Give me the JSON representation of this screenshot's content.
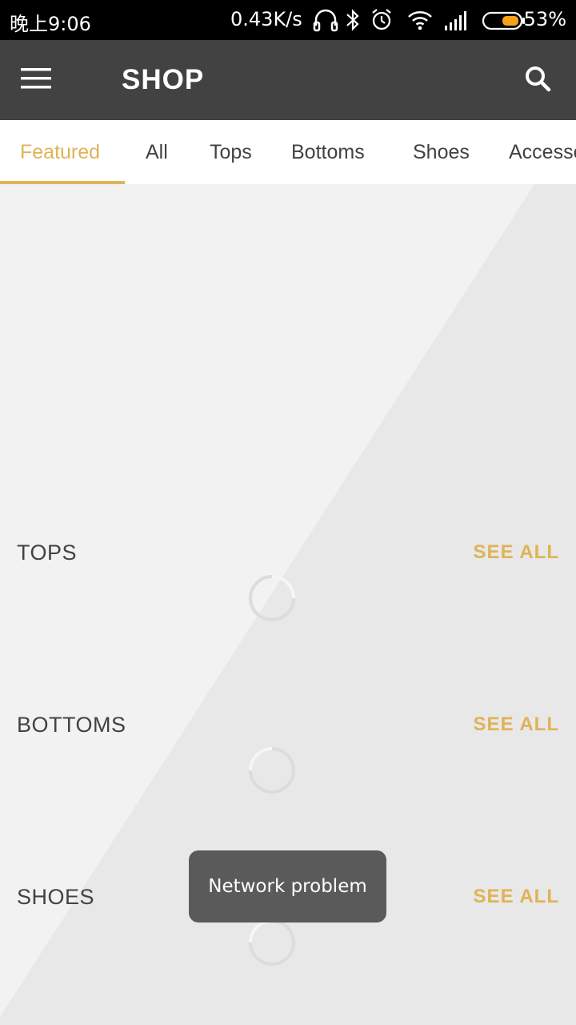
{
  "status_bar": {
    "time": "晚上9:06",
    "net_speed": "0.43K/s",
    "battery": "53%",
    "icons": [
      "headset-icon",
      "bluetooth-icon",
      "alarm-icon",
      "wifi-icon",
      "signal-icon",
      "battery-icon"
    ],
    "battery_level": 0.53
  },
  "app_bar": {
    "title": "SHOP",
    "menu_icon": "menu-icon",
    "search_icon": "search-icon"
  },
  "tabs": [
    {
      "label": "Featured",
      "active": true
    },
    {
      "label": "All"
    },
    {
      "label": "Tops"
    },
    {
      "label": "Bottoms"
    },
    {
      "label": "Shoes"
    },
    {
      "label": "Accessories"
    }
  ],
  "sections": [
    {
      "title": "TOPS",
      "action": "SEE ALL"
    },
    {
      "title": "BOTTOMS",
      "action": "SEE ALL"
    },
    {
      "title": "SHOES",
      "action": "SEE ALL"
    }
  ],
  "toast": {
    "message": "Network problem"
  },
  "colors": {
    "accent": "#e0b355",
    "app_bar": "#424242",
    "status_bar": "#000000",
    "background": "#f2f2f2"
  }
}
